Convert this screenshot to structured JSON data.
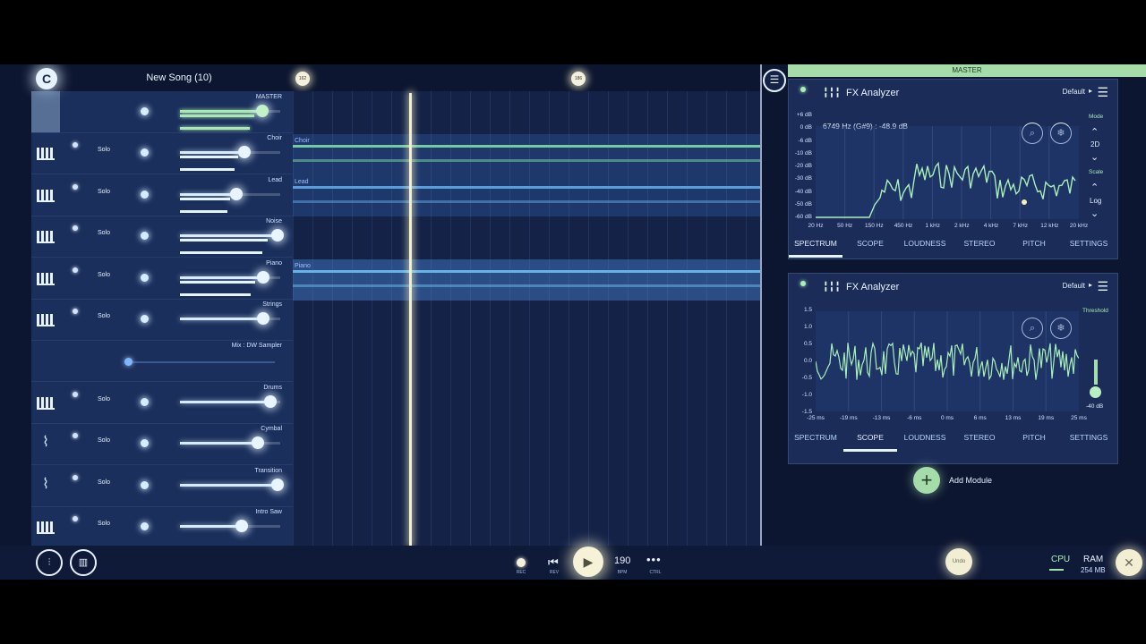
{
  "header": {
    "song_title": "New Song (10)",
    "logo_letter": "C",
    "markers": [
      "162",
      "186"
    ]
  },
  "mixer": {
    "solo_label": "Solo",
    "tracks": [
      {
        "name": "MASTER",
        "icon": "meter-icon",
        "level": 0.82,
        "type": "master"
      },
      {
        "name": "Choir",
        "icon": "piano-icon",
        "level": 0.64
      },
      {
        "name": "Lead",
        "icon": "piano-icon",
        "level": 0.56
      },
      {
        "name": "Noise",
        "icon": "piano-icon",
        "level": 0.97
      },
      {
        "name": "Piano",
        "icon": "piano-icon",
        "level": 0.83
      },
      {
        "name": "Strings",
        "icon": "piano-icon",
        "level": 0.83
      },
      {
        "name": "Mix : DW Sampler",
        "icon": "",
        "level": 0.0,
        "type": "bus"
      },
      {
        "name": "Drums",
        "icon": "piano-icon",
        "level": 0.9
      },
      {
        "name": "Cymbal",
        "icon": "waveform-icon",
        "level": 0.78
      },
      {
        "name": "Transition",
        "icon": "waveform-icon",
        "level": 0.97
      },
      {
        "name": "Intro Saw",
        "icon": "piano-icon",
        "level": 0.62
      }
    ]
  },
  "arrangement": {
    "lanes": [
      {
        "name": "Choir",
        "color": "#7fd9a6"
      },
      {
        "name": "Lead",
        "color": "#5fa8e8"
      },
      {
        "name": "Piano",
        "color": "#6cc0f0"
      }
    ]
  },
  "master_label": "MASTER",
  "analyzer_spectrum": {
    "title": "FX Analyzer",
    "preset": "Default",
    "readout": "6749 Hz (G#9) : -48.9 dB",
    "y_labels": [
      "+6 dB",
      "0 dB",
      "-6 dB",
      "-10 dB",
      "-20 dB",
      "-30 dB",
      "-40 dB",
      "-50 dB",
      "-60 dB"
    ],
    "x_labels": [
      "20 Hz",
      "50 Hz",
      "150 Hz",
      "450 Hz",
      "1 kHz",
      "2 kHz",
      "4 kHz",
      "7 kHz",
      "12 kHz",
      "20 kHz"
    ],
    "mode_label": "Mode",
    "mode_value": "2D",
    "scale_label": "Scale",
    "scale_value": "Log",
    "tabs": [
      "SPECTRUM",
      "SCOPE",
      "LOUDNESS",
      "STEREO",
      "PITCH",
      "SETTINGS"
    ],
    "active_tab": "SPECTRUM"
  },
  "analyzer_scope": {
    "title": "FX Analyzer",
    "preset": "Default",
    "y_labels": [
      "1.5",
      "1.0",
      "0.5",
      "0.0",
      "-0.5",
      "-1.0",
      "-1.5"
    ],
    "x_labels": [
      "-25 ms",
      "-19 ms",
      "-13 ms",
      "-6 ms",
      "0 ms",
      "6 ms",
      "13 ms",
      "19 ms",
      "25 ms"
    ],
    "threshold_label": "Threshold",
    "threshold_value": "-40 dB",
    "tabs": [
      "SPECTRUM",
      "SCOPE",
      "LOUDNESS",
      "STEREO",
      "PITCH",
      "SETTINGS"
    ],
    "active_tab": "SCOPE"
  },
  "add_module": "Add Module",
  "transport": {
    "rec": "REC",
    "rev": "REV",
    "bpm_value": "190",
    "bpm": "BPM",
    "ctrl": "CTRL",
    "undo": "Undo",
    "cpu": "CPU",
    "ram": "RAM",
    "ram_value": "254 MB"
  },
  "colors": {
    "accent_green": "#a6dca9",
    "background": "#0d1630",
    "panel": "#1e305f"
  }
}
